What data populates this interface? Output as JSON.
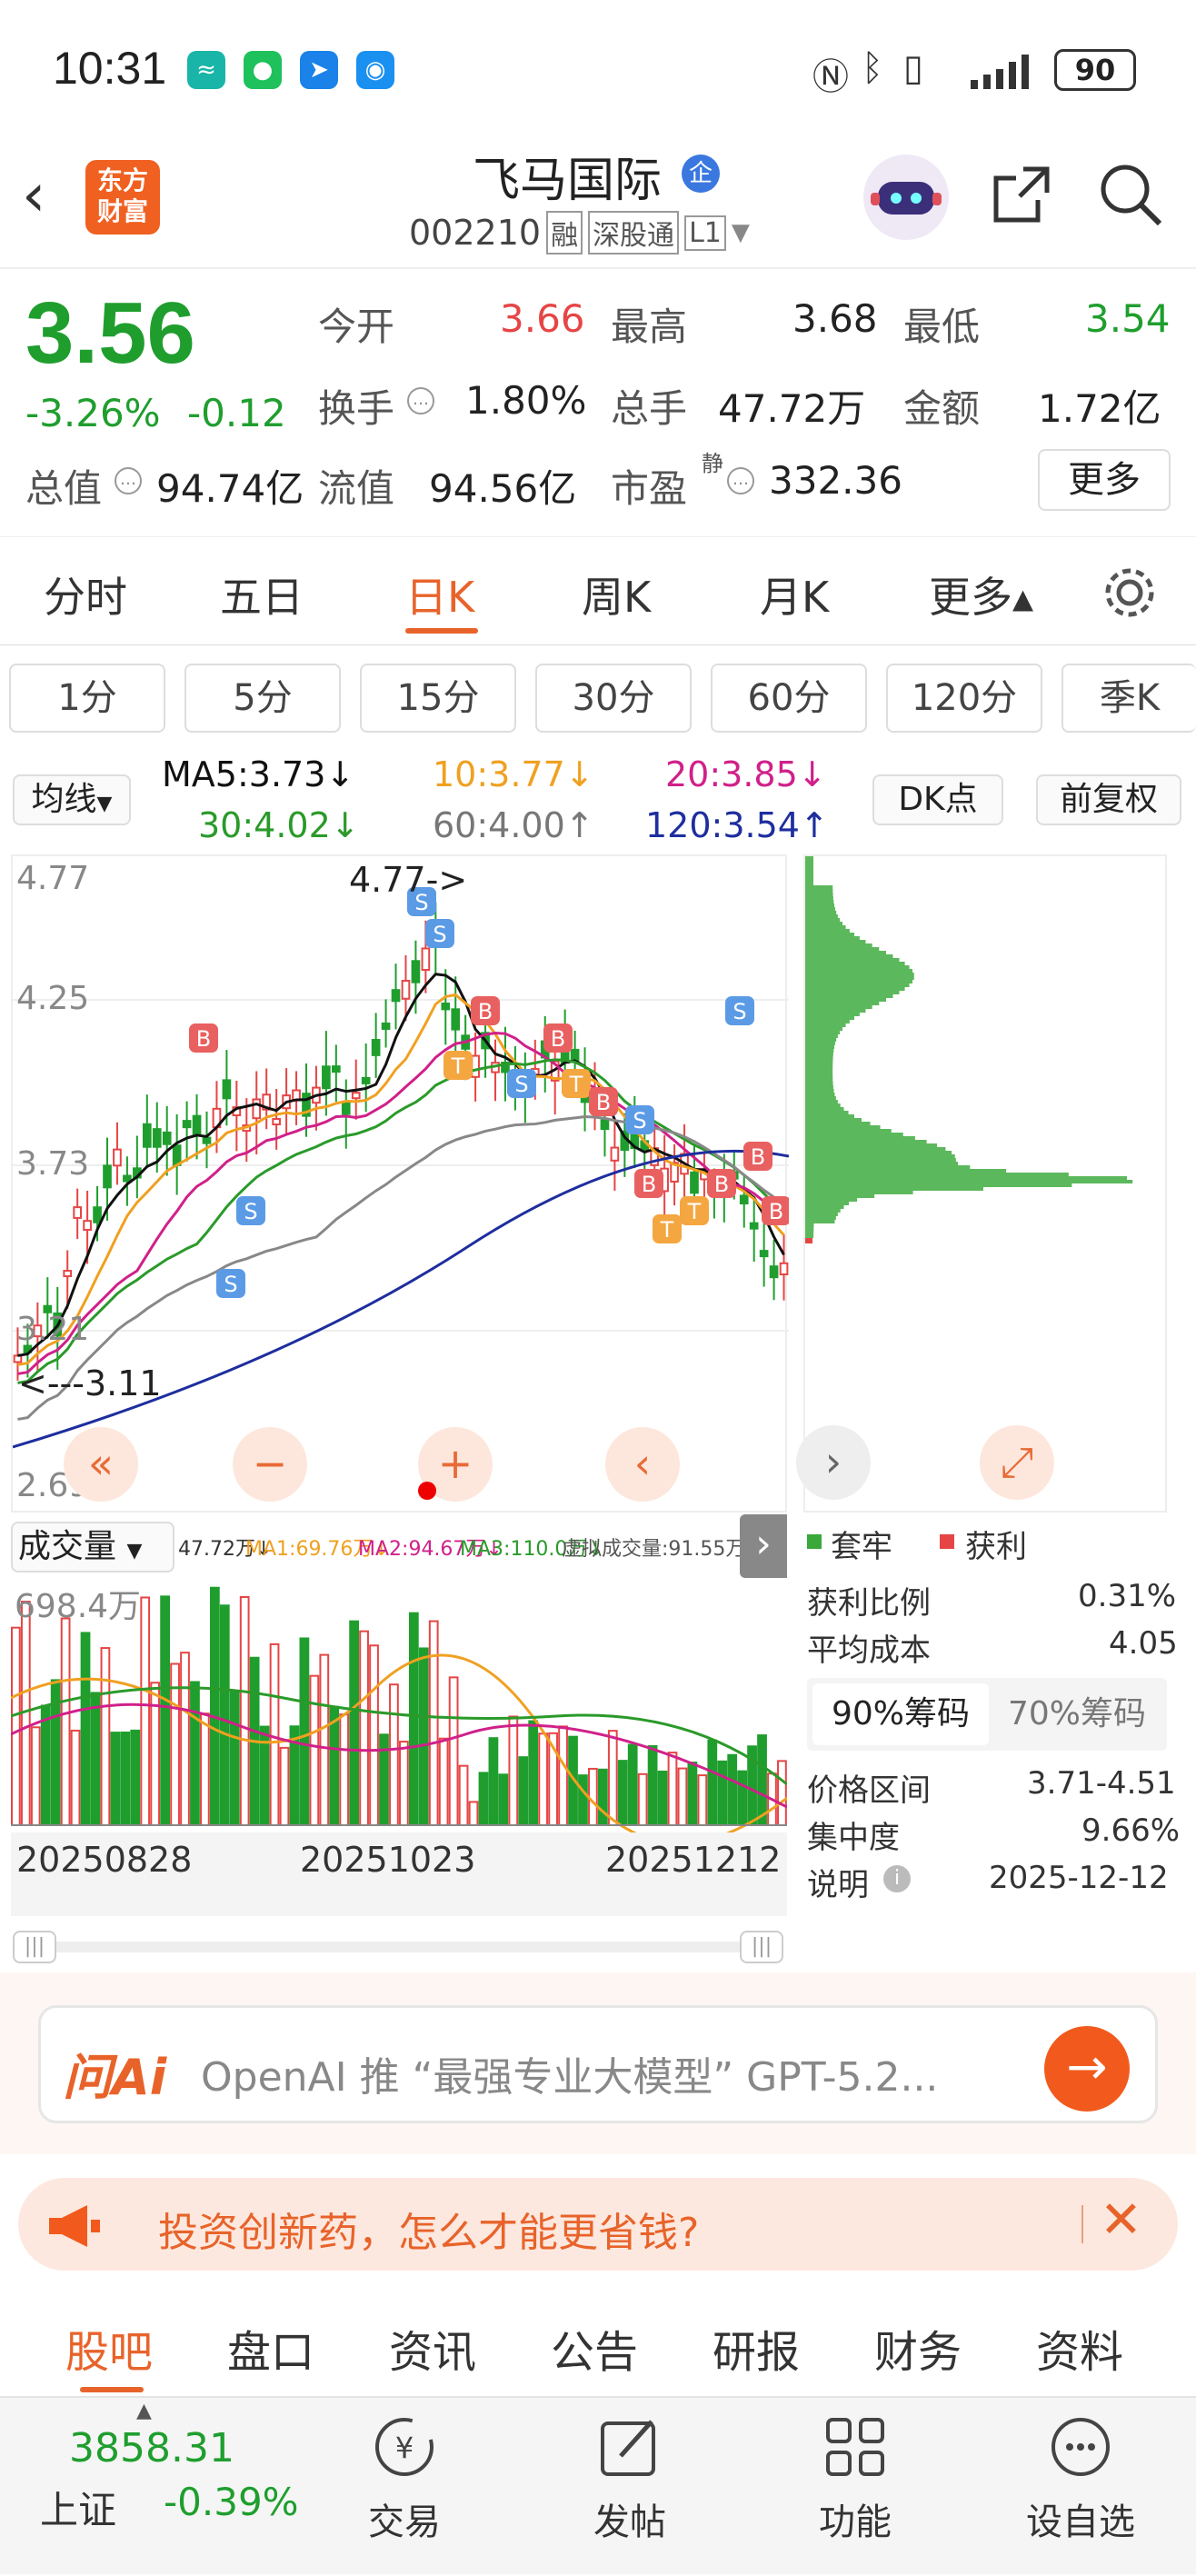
{
  "status": {
    "time": "10:31",
    "battery": "90"
  },
  "header": {
    "title": "飞马国际",
    "badge": "企",
    "code": "002210",
    "tags": [
      "融",
      "深股通",
      "L1"
    ],
    "brand": "东方\n财富"
  },
  "quote": {
    "price": "3.56",
    "pct": "-3.26%",
    "chg": "-0.12",
    "open_label": "今开",
    "open": "3.66",
    "high_label": "最高",
    "high": "3.68",
    "low_label": "最低",
    "low": "3.54",
    "turnover_label": "换手",
    "turnover": "1.80%",
    "vol_label": "总手",
    "vol": "47.72万",
    "amount_label": "金额",
    "amount": "1.72亿",
    "mcap_label": "总值",
    "mcap": "94.74亿",
    "float_label": "流值",
    "float": "94.56亿",
    "pe_label": "市盈",
    "pe_sup": "静",
    "pe": "332.36",
    "more": "更多"
  },
  "tabs": [
    "分时",
    "五日",
    "日K",
    "周K",
    "月K",
    "更多▴"
  ],
  "period_tabs": [
    "1分",
    "5分",
    "15分",
    "30分",
    "60分",
    "120分",
    "季K"
  ],
  "ma_line": {
    "selector": "均线",
    "ma5": "MA5:3.73↓",
    "ma10": "10:3.77↓",
    "ma20": "20:3.85↓",
    "ma30": "30:4.02↓",
    "ma60": "60:4.00↑",
    "ma120": "120:3.54↑",
    "dk": "DK点",
    "adj": "前复权"
  },
  "chart": {
    "y_top": "4.77",
    "y_2": "4.25",
    "y_3": "3.73",
    "y_4": "3.21",
    "y_bottom": "2.69",
    "max_ann": "4.77->",
    "min_ann": "<---3.11",
    "colors": {
      "up": "#e64545",
      "down": "#1f9e2e",
      "ma5": "#111111",
      "ma10": "#f0a020",
      "ma20": "#d0208a",
      "ma30": "#2a9a2a",
      "ma60": "#888888",
      "ma120": "#1e2e9e"
    }
  },
  "volume": {
    "selector": "成交量",
    "vol": "47.72万↓",
    "ma1": "MA1:69.76万↓",
    "ma2": "MA2:94.67万↓",
    "ma3": "MA3:110.0万↓",
    "virtual": "虚拟成交量:91.55万",
    "max": "698.4万",
    "dates": [
      "20250828",
      "20251023",
      "20251212"
    ]
  },
  "chips": {
    "legend_trap": "套牢",
    "legend_profit": "获利",
    "profit_ratio_label": "获利比例",
    "profit_ratio": "0.31%",
    "avg_cost_label": "平均成本",
    "avg_cost": "4.05",
    "tab90": "90%筹码",
    "tab70": "70%筹码",
    "range_label": "价格区间",
    "range": "3.71-4.51",
    "conc_label": "集中度",
    "conc": "9.66%",
    "note_label": "说明",
    "note_date": "2025-12-12"
  },
  "ai": {
    "logo": "问Ai",
    "text": "OpenAI 推 “最强专业大模型” GPT-5.2..."
  },
  "banner": {
    "text": "投资创新药，怎么才能更省钱?"
  },
  "bottom_tabs": [
    "股吧",
    "盘口",
    "资讯",
    "公告",
    "研报",
    "财务",
    "资料"
  ],
  "footer": {
    "index_value": "3858.31",
    "index_name": "上证",
    "index_pct": "-0.39%",
    "trade": "交易",
    "post": "发帖",
    "func": "功能",
    "watch": "设自选"
  }
}
